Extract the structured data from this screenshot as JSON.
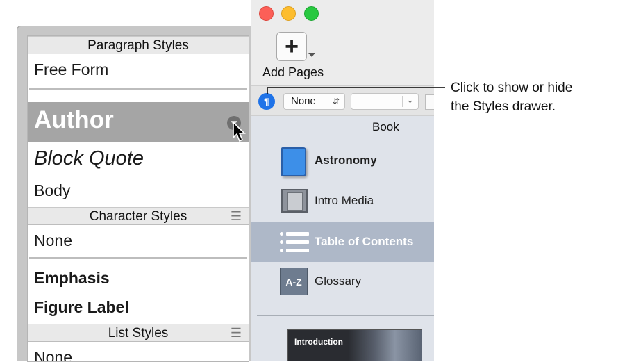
{
  "drawer": {
    "paragraph_styles": {
      "header": "Paragraph Styles",
      "items": [
        "Free Form",
        "Author",
        "Block Quote",
        "Body"
      ]
    },
    "character_styles": {
      "header": "Character Styles",
      "items": [
        "None",
        "Emphasis",
        "Figure Label"
      ]
    },
    "list_styles": {
      "header": "List Styles",
      "items": [
        "None"
      ]
    }
  },
  "window": {
    "toolbar": {
      "add_pages_label": "Add Pages",
      "add_pages_symbol": "+"
    },
    "format_bar": {
      "styles_toggle_symbol": "¶",
      "style_select_value": "None"
    },
    "sidebar": {
      "title": "Book",
      "items": [
        {
          "label": "Astronomy",
          "icon": "book-icon"
        },
        {
          "label": "Intro Media",
          "icon": "film-icon"
        },
        {
          "label": "Table of Contents",
          "icon": "list-icon",
          "selected": true
        },
        {
          "label": "Glossary",
          "icon": "az-icon"
        }
      ],
      "az_icon_text": "A-Z",
      "thumbnail_label": "Introduction"
    }
  },
  "callout": {
    "line1": "Click to show or hide",
    "line2": "the Styles drawer."
  },
  "colors": {
    "accent_blue": "#1f73e8",
    "selection_gray": "#a5a5a5",
    "sidebar_selection": "#aeb8c8"
  }
}
